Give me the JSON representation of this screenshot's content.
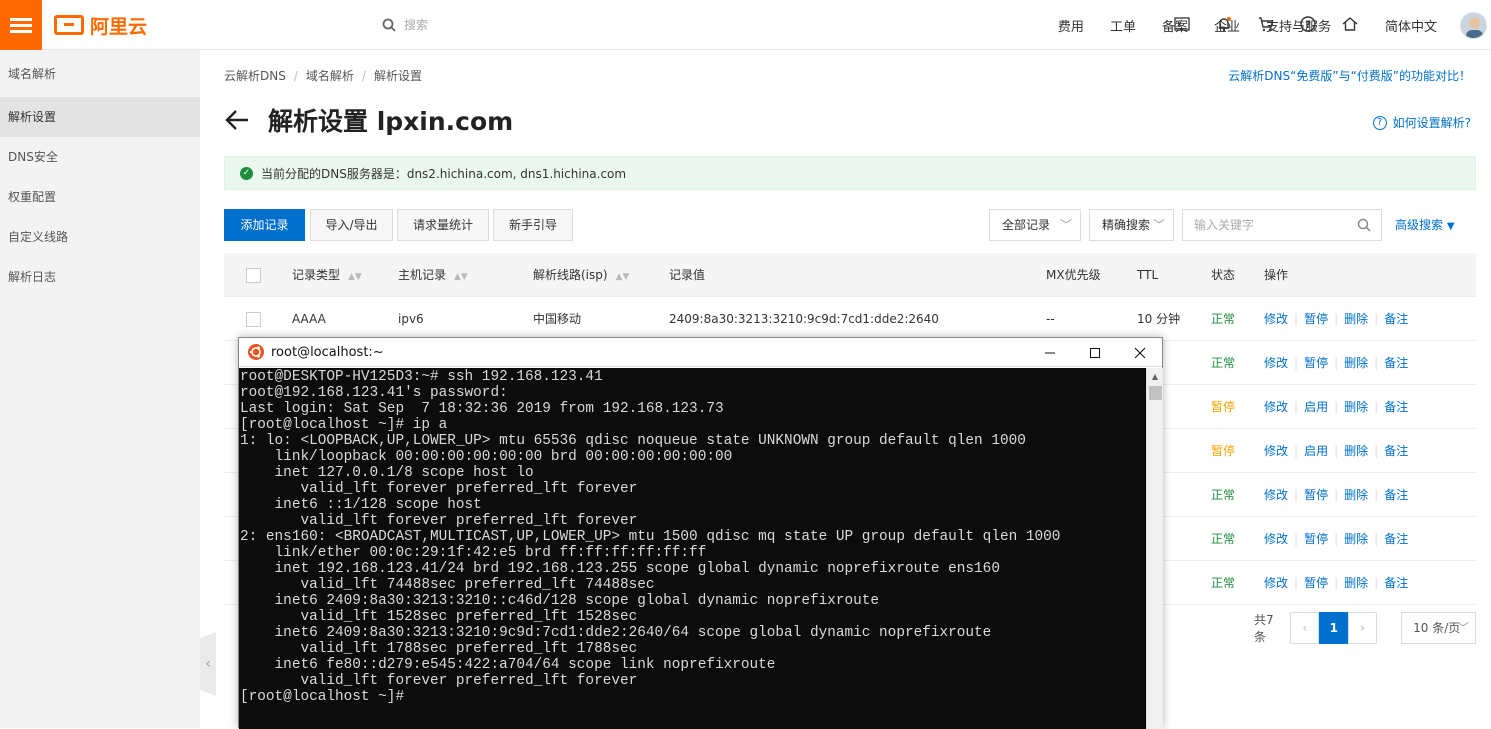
{
  "topbar": {
    "logo_text": "阿里云",
    "search_placeholder": "搜索",
    "nav": [
      "费用",
      "工单",
      "备案",
      "企业",
      "支持与服务"
    ],
    "icons": [
      "terminal-icon",
      "bell-icon",
      "cart-icon",
      "help-icon",
      "home-icon"
    ],
    "language": "简体中文",
    "accent_color": "#ff6a00"
  },
  "sidebar": {
    "items": [
      {
        "label": "域名解析"
      },
      {
        "label": "解析设置"
      },
      {
        "label": "DNS安全"
      },
      {
        "label": "权重配置"
      },
      {
        "label": "自定义线路"
      },
      {
        "label": "解析日志"
      }
    ],
    "active_index": 1
  },
  "breadcrumb": [
    "云解析DNS",
    "域名解析",
    "解析设置"
  ],
  "compare_link": "云解析DNS“免费版”与“付费版”的功能对比！",
  "page_title": "解析设置 lpxin.com",
  "help_link": "如何设置解析?",
  "notice": "当前分配的DNS服务器是：dns2.hichina.com, dns1.hichina.com",
  "toolbar": {
    "add": "添加记录",
    "import_export": "导入/导出",
    "stats": "请求量统计",
    "guide": "新手引导",
    "filter_select": "全部记录",
    "match_select": "精确搜索",
    "keyword_placeholder": "输入关键字",
    "advanced": "高级搜索"
  },
  "table": {
    "headers": [
      "记录类型",
      "主机记录",
      "解析线路(isp)",
      "记录值",
      "MX优先级",
      "TTL",
      "状态",
      "操作"
    ],
    "rows": [
      {
        "type": "AAAA",
        "host": "ipv6",
        "line": "中国移动",
        "value": "2409:8a30:3213:3210:9c9d:7cd1:dde2:2640",
        "mx": "--",
        "ttl": "10 分钟",
        "status": "正常",
        "toggle": "暂停"
      },
      {
        "type": "",
        "host": "",
        "line": "",
        "value": "",
        "mx": "",
        "ttl": "钟",
        "status": "正常",
        "toggle": "暂停"
      },
      {
        "type": "",
        "host": "",
        "line": "",
        "value": "",
        "mx": "",
        "ttl": "钟",
        "status": "暂停",
        "toggle": "启用"
      },
      {
        "type": "",
        "host": "",
        "line": "",
        "value": "",
        "mx": "",
        "ttl": "钟",
        "status": "暂停",
        "toggle": "启用"
      },
      {
        "type": "",
        "host": "",
        "line": "",
        "value": "",
        "mx": "",
        "ttl": "钟",
        "status": "正常",
        "toggle": "暂停"
      },
      {
        "type": "",
        "host": "",
        "line": "",
        "value": "",
        "mx": "",
        "ttl": "钟",
        "status": "正常",
        "toggle": "暂停"
      },
      {
        "type": "",
        "host": "",
        "line": "",
        "value": "",
        "mx": "",
        "ttl": "钟",
        "status": "正常",
        "toggle": "暂停"
      }
    ],
    "actions": {
      "edit": "修改",
      "delete": "删除",
      "note": "备注"
    }
  },
  "pager": {
    "total": "共7条",
    "current": "1",
    "page_size": "10 条/页"
  },
  "terminal": {
    "title": "root@localhost:~",
    "lines": [
      "root@DESKTOP-HV125D3:~# ssh 192.168.123.41",
      "root@192.168.123.41's password:",
      "Last login: Sat Sep  7 18:32:36 2019 from 192.168.123.73",
      "[root@localhost ~]# ip a",
      "1: lo: <LOOPBACK,UP,LOWER_UP> mtu 65536 qdisc noqueue state UNKNOWN group default qlen 1000",
      "    link/loopback 00:00:00:00:00:00 brd 00:00:00:00:00:00",
      "    inet 127.0.0.1/8 scope host lo",
      "       valid_lft forever preferred_lft forever",
      "    inet6 ::1/128 scope host",
      "       valid_lft forever preferred_lft forever",
      "2: ens160: <BROADCAST,MULTICAST,UP,LOWER_UP> mtu 1500 qdisc mq state UP group default qlen 1000",
      "    link/ether 00:0c:29:1f:42:e5 brd ff:ff:ff:ff:ff:ff",
      "    inet 192.168.123.41/24 brd 192.168.123.255 scope global dynamic noprefixroute ens160",
      "       valid_lft 74488sec preferred_lft 74488sec",
      "    inet6 2409:8a30:3213:3210::c46d/128 scope global dynamic noprefixroute",
      "       valid_lft 1528sec preferred_lft 1528sec",
      "    inet6 2409:8a30:3213:3210:9c9d:7cd1:dde2:2640/64 scope global dynamic noprefixroute",
      "       valid_lft 1788sec preferred_lft 1788sec",
      "    inet6 fe80::d279:e545:422:a704/64 scope link noprefixroute",
      "       valid_lft forever preferred_lft forever",
      "[root@localhost ~]#"
    ]
  }
}
